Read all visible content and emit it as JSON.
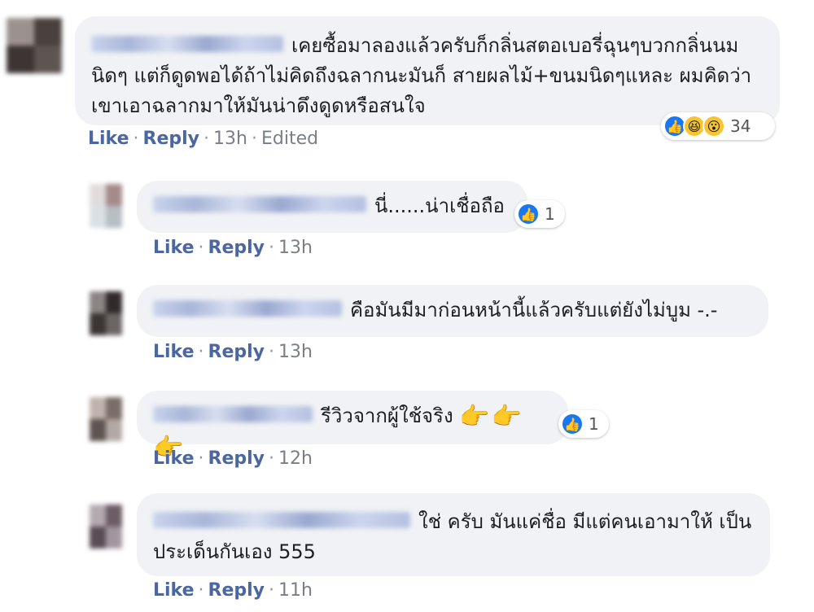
{
  "comments": [
    {
      "text": "เคยซื้อมาลองแล้วครับก็กลิ่นสตอเบอรี่ฉุนๆบวกกลิ่นนมนิดๆ แต่ก็ดูดพอได้ถ้าไม่คิดถึงฉลากนะมันก็ สายผลไม้+ขนมนิดๆแหละ ผมคิดว่าเขาเอาฉลากมาให้มันน่าดึงดูดหรือสนใจ",
      "reaction_count": "34",
      "like": "Like",
      "reply": "Reply",
      "time": "13h",
      "edited": "Edited"
    },
    {
      "text": "นี่......น่าเชื่อถือ",
      "reaction_count": "1",
      "like": "Like",
      "reply": "Reply",
      "time": "13h"
    },
    {
      "text": "คือมันมีมาก่อนหน้านี้แล้วครับแต่ยังไม่บูม -.-",
      "like": "Like",
      "reply": "Reply",
      "time": "13h"
    },
    {
      "text": "รีวิวจากผู้ใช้จริง",
      "emoji": "👉👉👉",
      "reaction_count": "1",
      "like": "Like",
      "reply": "Reply",
      "time": "12h"
    },
    {
      "text": "ใช่ ครับ มันแค่ชื่อ มีแต่คนเอามาให้ เป็นประเด็นกันเอง 555",
      "like": "Like",
      "reply": "Reply",
      "time": "11h"
    }
  ],
  "separator": "·",
  "icons": {
    "like": "thumbs-up-icon",
    "haha": "laughing-face-icon",
    "wow": "surprised-face-icon"
  }
}
